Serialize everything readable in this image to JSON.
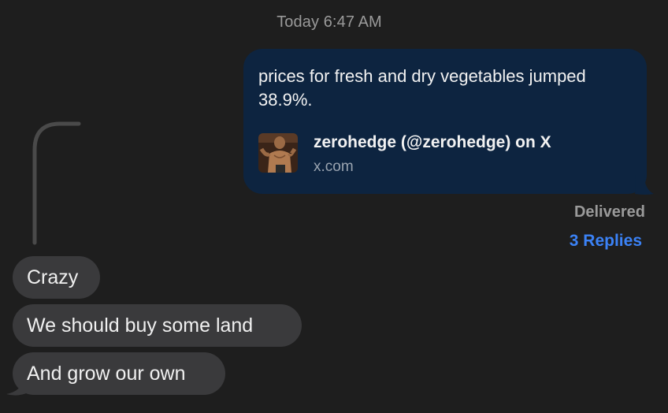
{
  "timestamp": "Today 6:47 AM",
  "outgoing": {
    "text": "prices for fresh and dry vegetables jumped 38.9%.",
    "link": {
      "title": "zerohedge (@zerohedge) on X",
      "domain": "x.com"
    }
  },
  "status": {
    "delivered": "Delivered",
    "replies": "3 Replies"
  },
  "incoming": [
    {
      "text": "Crazy"
    },
    {
      "text": "We should buy some land"
    },
    {
      "text": "And grow our own"
    }
  ],
  "colors": {
    "background": "#1e1e1e",
    "outgoing_bubble": "#0d2440",
    "incoming_bubble": "#3a3a3c",
    "replies_link": "#3b82f6",
    "muted_text": "#9a9a9a"
  }
}
